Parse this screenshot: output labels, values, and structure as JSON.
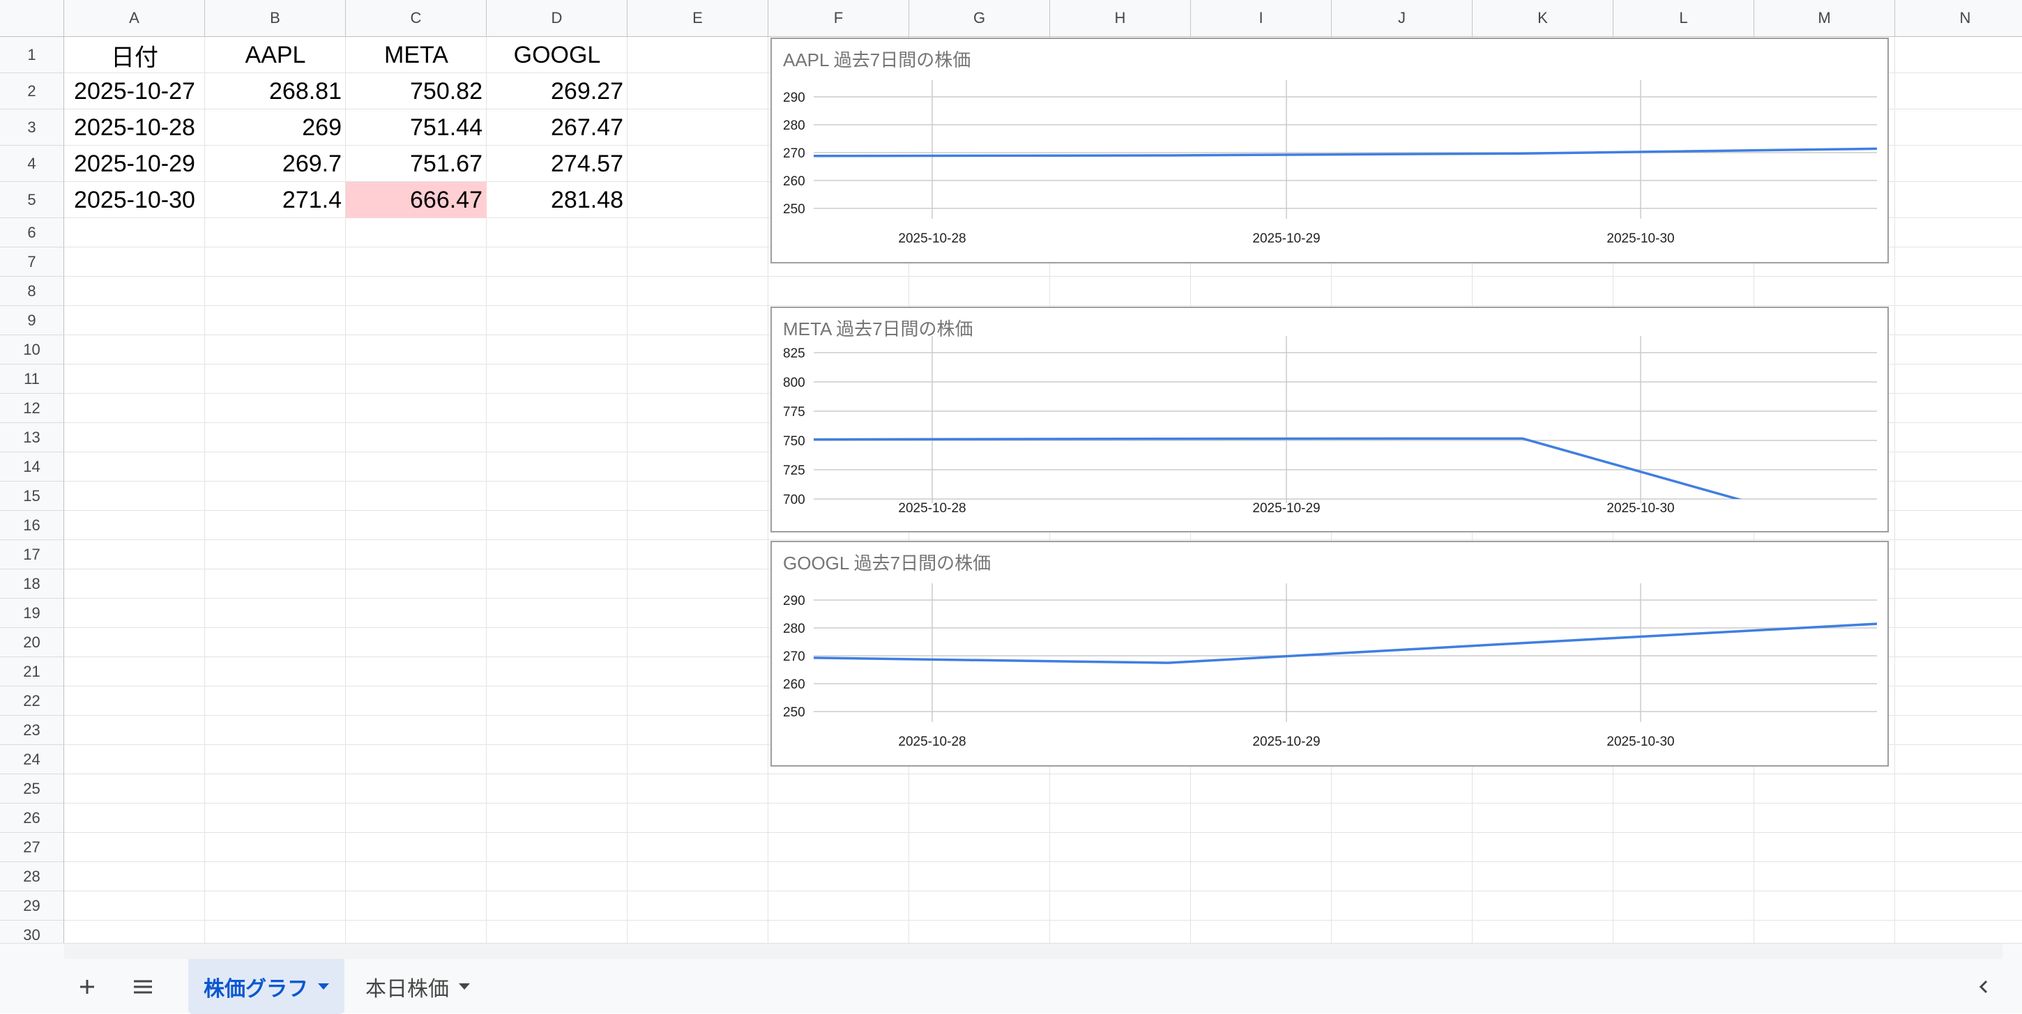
{
  "columns": [
    "A",
    "B",
    "C",
    "D",
    "E",
    "F",
    "G",
    "H",
    "I",
    "J",
    "K",
    "L",
    "M",
    "N"
  ],
  "rows": [
    "1",
    "2",
    "3",
    "4",
    "5",
    "6",
    "7",
    "8",
    "9",
    "10",
    "11",
    "12",
    "13",
    "14",
    "15",
    "16",
    "17",
    "18",
    "19",
    "20",
    "21",
    "22",
    "23",
    "24",
    "25",
    "26",
    "27",
    "28",
    "29",
    "30"
  ],
  "table": {
    "headers": [
      "日付",
      "AAPL",
      "META",
      "GOOGL"
    ],
    "rows": [
      [
        "2025-10-27",
        "268.81",
        "750.82",
        "269.27"
      ],
      [
        "2025-10-28",
        "269",
        "751.44",
        "267.47"
      ],
      [
        "2025-10-29",
        "269.7",
        "751.67",
        "274.57"
      ],
      [
        "2025-10-30",
        "271.4",
        "666.47",
        "281.48"
      ]
    ]
  },
  "colors": {
    "line": "#3f7fe0",
    "highlight": "#ffcfd3",
    "active_tab": "#0b57d0"
  },
  "chart_data": [
    {
      "type": "line",
      "title": "AAPL 過去7日間の株価",
      "x": [
        "2025-10-27",
        "2025-10-28",
        "2025-10-29",
        "2025-10-30"
      ],
      "tick_labels_x": [
        "2025-10-28",
        "2025-10-29",
        "2025-10-30"
      ],
      "series": [
        {
          "values": [
            268.81,
            269,
            269.7,
            271.4
          ]
        }
      ],
      "yticks": [
        "290",
        "280",
        "270",
        "260",
        "250"
      ],
      "ylim": [
        250,
        290
      ],
      "grid": true
    },
    {
      "type": "line",
      "title": "META 過去7日間の株価",
      "x": [
        "2025-10-27",
        "2025-10-28",
        "2025-10-29",
        "2025-10-30"
      ],
      "tick_labels_x": [
        "2025-10-28",
        "2025-10-29",
        "2025-10-30"
      ],
      "series": [
        {
          "values": [
            750.82,
            751.44,
            751.67,
            666.47
          ]
        }
      ],
      "yticks": [
        "825",
        "800",
        "775",
        "750",
        "725",
        "700"
      ],
      "ylim": [
        700,
        825
      ],
      "grid": true
    },
    {
      "type": "line",
      "title": "GOOGL 過去7日間の株価",
      "x": [
        "2025-10-27",
        "2025-10-28",
        "2025-10-29",
        "2025-10-30"
      ],
      "tick_labels_x": [
        "2025-10-28",
        "2025-10-29",
        "2025-10-30"
      ],
      "series": [
        {
          "values": [
            269.27,
            267.47,
            274.57,
            281.48
          ]
        }
      ],
      "yticks": [
        "290",
        "280",
        "270",
        "260",
        "250"
      ],
      "ylim": [
        250,
        290
      ],
      "grid": true
    }
  ],
  "sheet_tabs": [
    {
      "label": "株価グラフ",
      "active": true
    },
    {
      "label": "本日株価",
      "active": false
    }
  ],
  "icons": {
    "add_sheet": "plus-icon",
    "all_sheets": "menu-icon",
    "scroll_left": "chevron-left-icon"
  }
}
